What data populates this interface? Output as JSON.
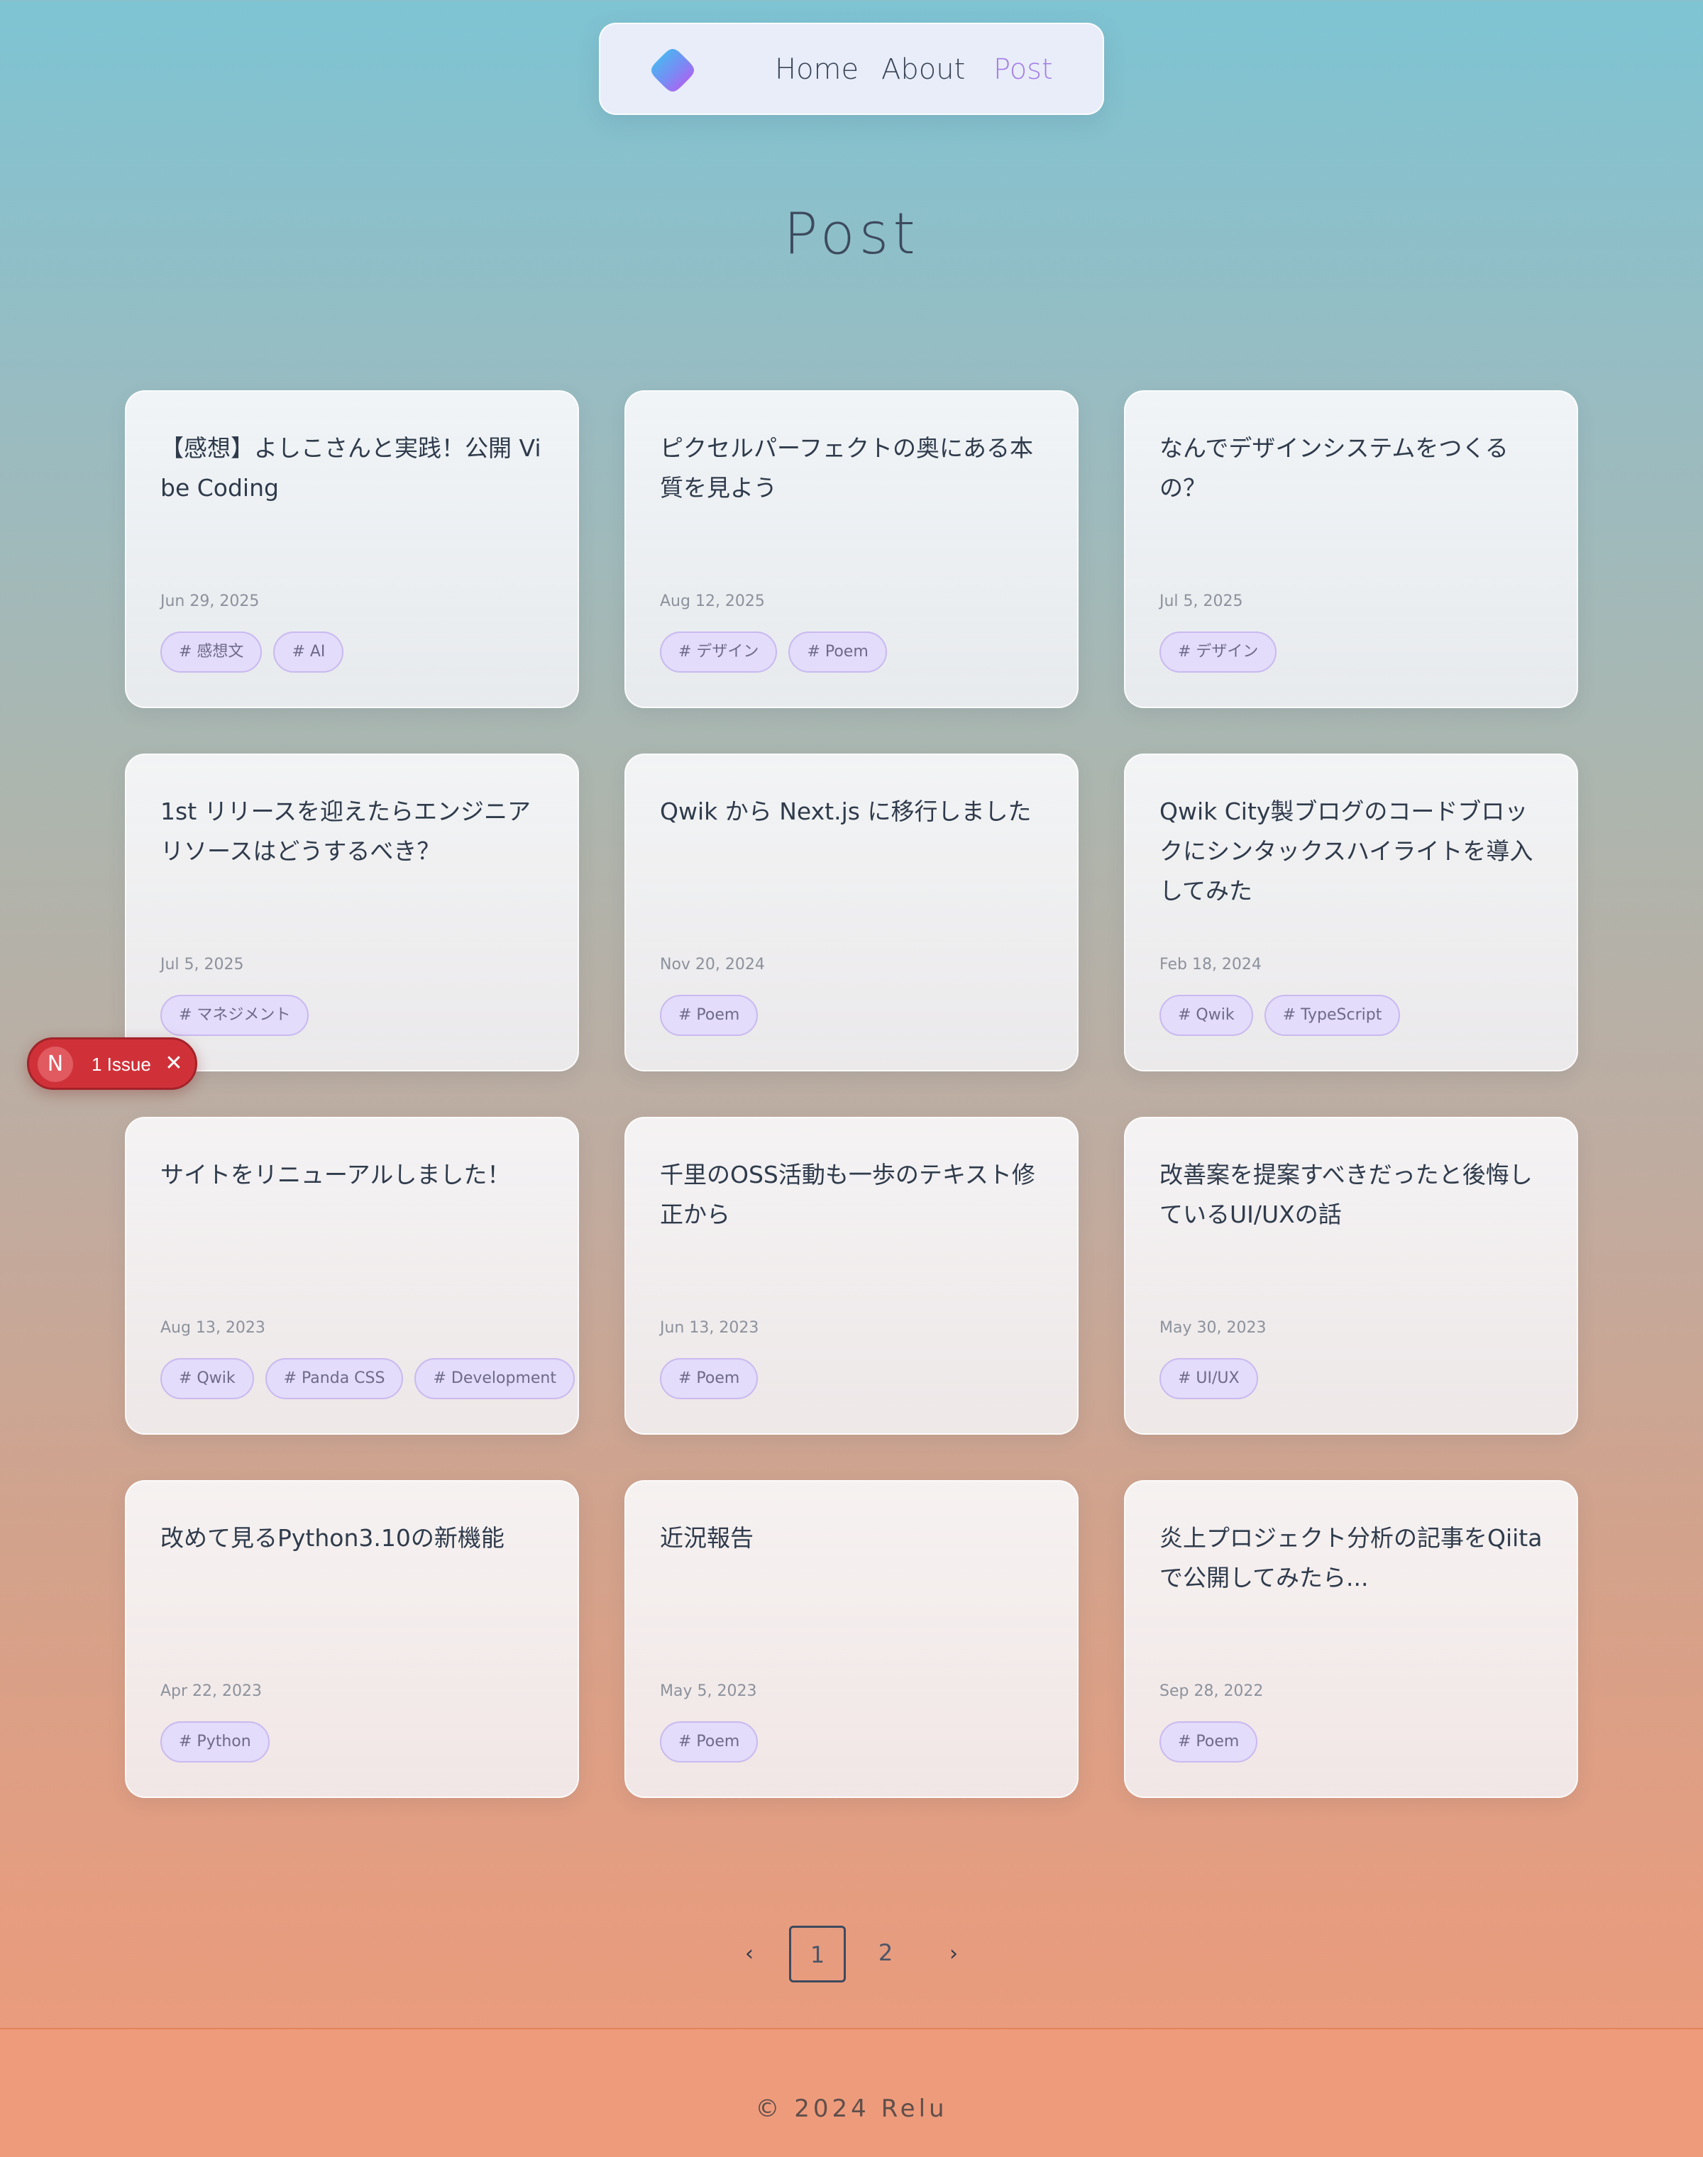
{
  "nav": {
    "logo_icon": "gradient-diamond-logo",
    "links": [
      {
        "label": "Home"
      },
      {
        "label": "About"
      },
      {
        "label": "Post",
        "active": true
      }
    ],
    "active_color": "#a47de6"
  },
  "page": {
    "title": "Post"
  },
  "posts": [
    {
      "title": "【感想】よしこさんと実践！公開 Vibe Coding",
      "date": "Jun 29, 2025",
      "tags": [
        "# 感想文",
        "# AI"
      ]
    },
    {
      "title": "ピクセルパーフェクトの奥にある本質を見よう",
      "date": "Aug 12, 2025",
      "tags": [
        "# デザイン",
        "# Poem"
      ]
    },
    {
      "title": "なんでデザインシステムをつくるの？",
      "date": "Jul 5, 2025",
      "tags": [
        "# デザイン"
      ]
    },
    {
      "title": "1st リリースを迎えたらエンジニアリソースはどうするべき？",
      "date": "Jul 5, 2025",
      "tags": [
        "# マネジメント"
      ]
    },
    {
      "title": "Qwik から Next.js に移行しました",
      "date": "Nov 20, 2024",
      "tags": [
        "# Poem"
      ]
    },
    {
      "title": "Qwik City製ブログのコードブロックにシンタックスハイライトを導入してみた",
      "date": "Feb 18, 2024",
      "tags": [
        "# Qwik",
        "# TypeScript"
      ]
    },
    {
      "title": "サイトをリニューアルしました！",
      "date": "Aug 13, 2023",
      "tags": [
        "# Qwik",
        "# Panda CSS",
        "# Development"
      ]
    },
    {
      "title": "千里のOSS活動も一歩のテキスト修正から",
      "date": "Jun 13, 2023",
      "tags": [
        "# Poem"
      ]
    },
    {
      "title": "改善案を提案すべきだったと後悔しているUI/UXの話",
      "date": "May 30, 2023",
      "tags": [
        "# UI/UX"
      ]
    },
    {
      "title": "改めて見るPython3.10の新機能",
      "date": "Apr 22, 2023",
      "tags": [
        "# Python"
      ]
    },
    {
      "title": "近況報告",
      "date": "May 5, 2023",
      "tags": [
        "# Poem"
      ]
    },
    {
      "title": "炎上プロジェクト分析の記事をQiitaで公開してみたら...",
      "date": "Sep 28, 2022",
      "tags": [
        "# Poem"
      ]
    }
  ],
  "issue_badge": {
    "logo_letter": "N",
    "text": "1 Issue",
    "close_icon": "close-icon",
    "close_glyph": "✕",
    "color": "#d03138"
  },
  "pagination": {
    "prev_glyph": "‹",
    "next_glyph": "›",
    "current_page": "1",
    "other_page": "2"
  },
  "footer": {
    "text": "© 2024 Relu"
  }
}
